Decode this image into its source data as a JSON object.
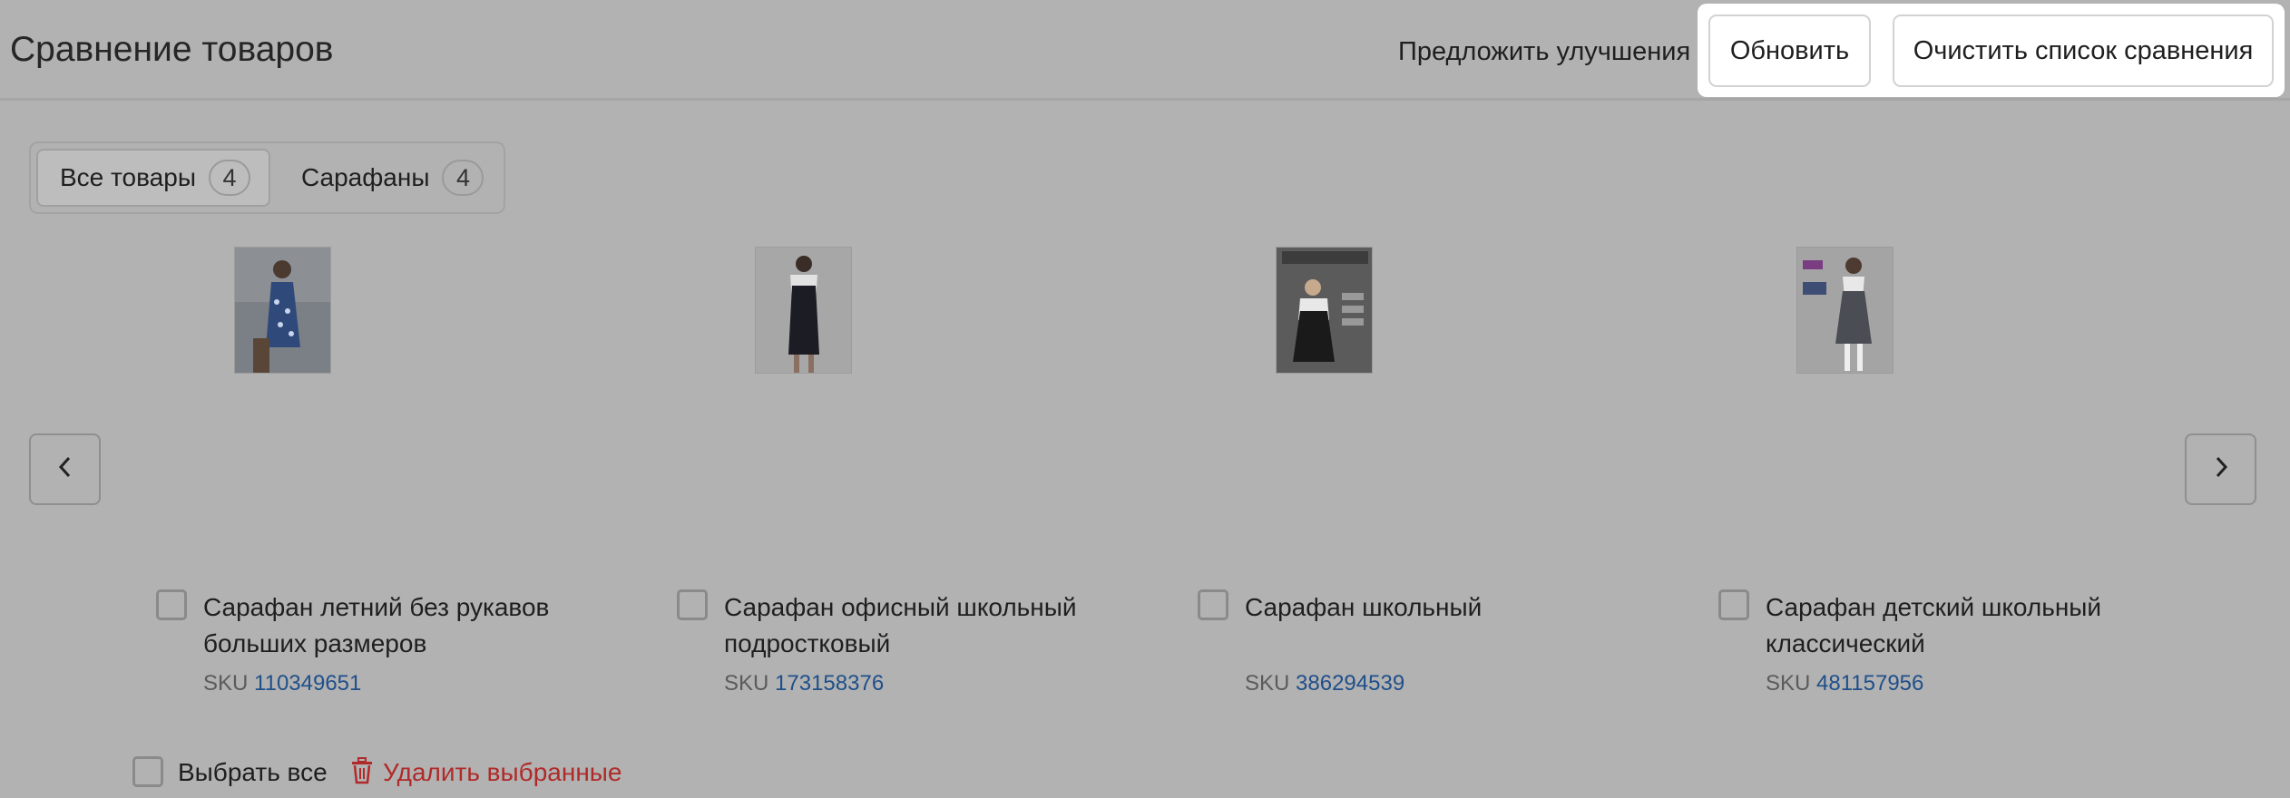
{
  "header": {
    "title": "Сравнение товаров",
    "suggest_label": "Предложить улучшения",
    "refresh_label": "Обновить",
    "clear_label": "Очистить список сравнения"
  },
  "tabs": [
    {
      "label": "Все товары",
      "count": "4",
      "active": true
    },
    {
      "label": "Сарафаны",
      "count": "4",
      "active": false
    }
  ],
  "products": [
    {
      "name": "Сарафан летний без рукавов больших размеров",
      "sku_label": "SKU",
      "sku": "110349651"
    },
    {
      "name": "Сарафан офисный школьный подростковый",
      "sku_label": "SKU",
      "sku": "173158376"
    },
    {
      "name": "Сарафан школьный",
      "sku_label": "SKU",
      "sku": "386294539"
    },
    {
      "name": "Сарафан детский школьный классический",
      "sku_label": "SKU",
      "sku": "481157956"
    }
  ],
  "footer": {
    "select_all_label": "Выбрать все",
    "delete_selected_label": "Удалить выбранные"
  },
  "icons": {
    "prev": "chevron-left-icon",
    "next": "chevron-right-icon",
    "delete": "trash-icon"
  },
  "colors": {
    "delete": "#b02a2a",
    "sku_link": "#1f4f8a",
    "highlight": "#ffffff"
  }
}
